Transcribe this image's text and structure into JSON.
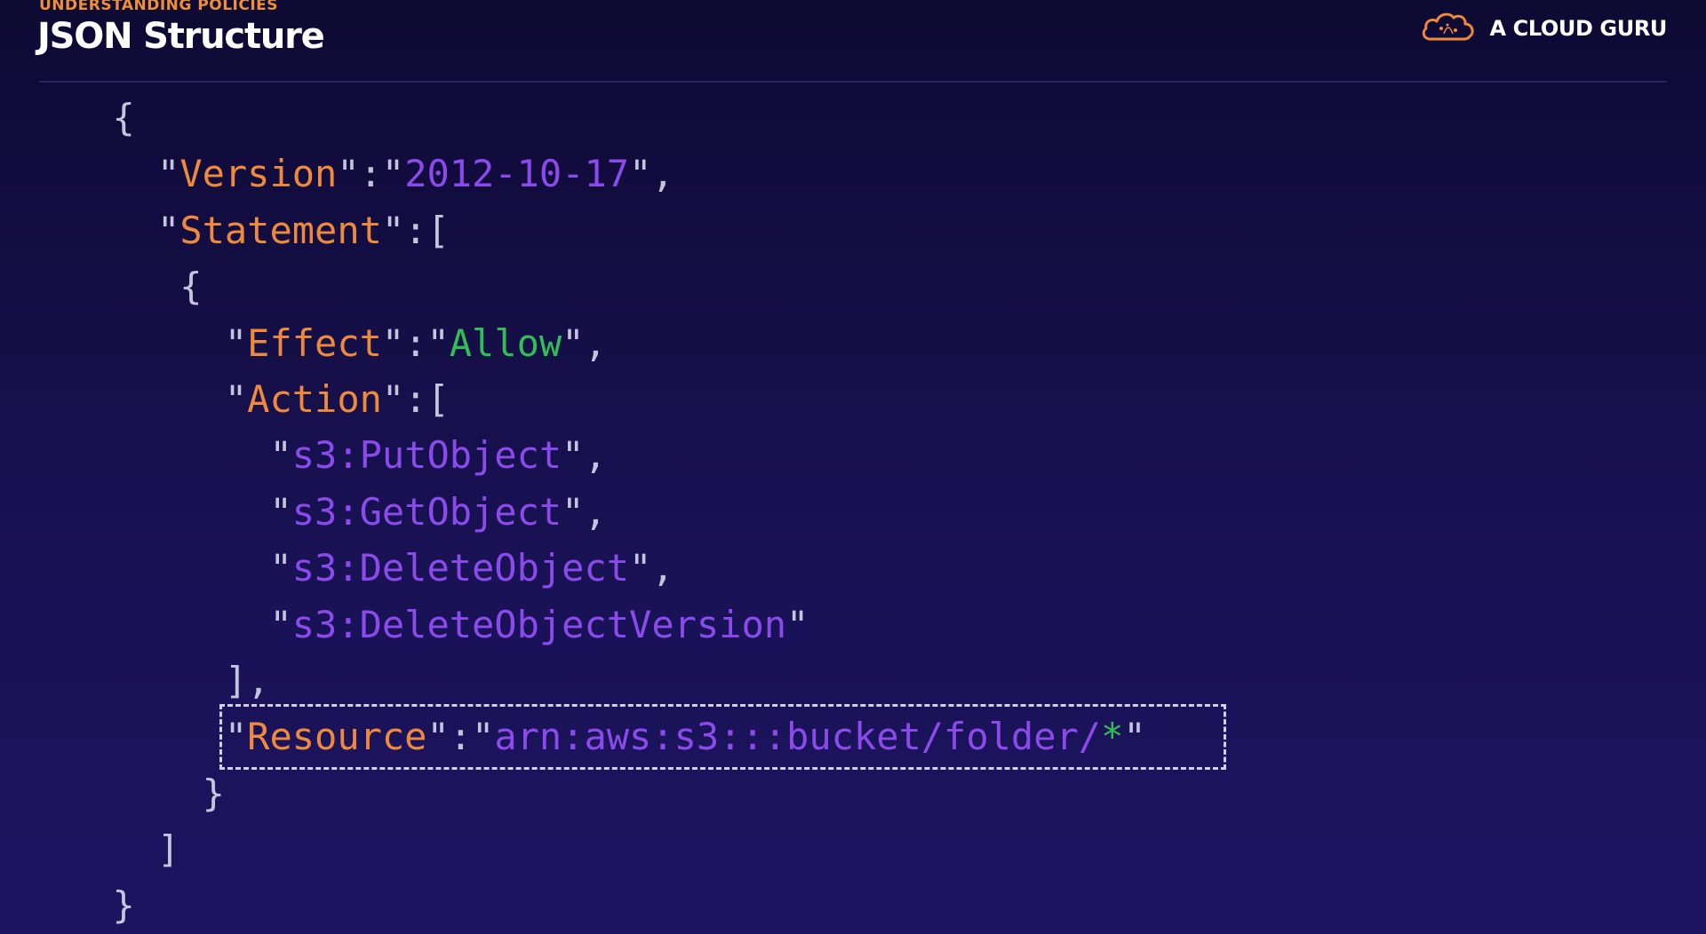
{
  "header": {
    "eyebrow": "UNDERSTANDING POLICIES",
    "title": "JSON Structure",
    "brand_name": "A CLOUD GURU",
    "brand_logo_icon": "cloud-icon"
  },
  "colors": {
    "background": "#140e44",
    "accent_orange": "#ee8a3c",
    "string_purple": "#8a4bea",
    "value_green": "#2fbf54",
    "punctuation": "#c6c3dc"
  },
  "code": {
    "open_brace": "{",
    "version_key": "Version",
    "version_value": "2012-10-17",
    "statement_key": "Statement",
    "statement_open": "[",
    "object_open": "{",
    "effect_key": "Effect",
    "effect_value": "Allow",
    "action_key": "Action",
    "action_open": "[",
    "actions": [
      "s3:PutObject",
      "s3:GetObject",
      "s3:DeleteObject",
      "s3:DeleteObjectVersion"
    ],
    "action_close": "],",
    "resource_key": "Resource",
    "resource_value": "arn:aws:s3:::bucket/folder/",
    "resource_wildcard": "*",
    "object_close": "}",
    "statement_close": "]",
    "close_brace": "}"
  }
}
